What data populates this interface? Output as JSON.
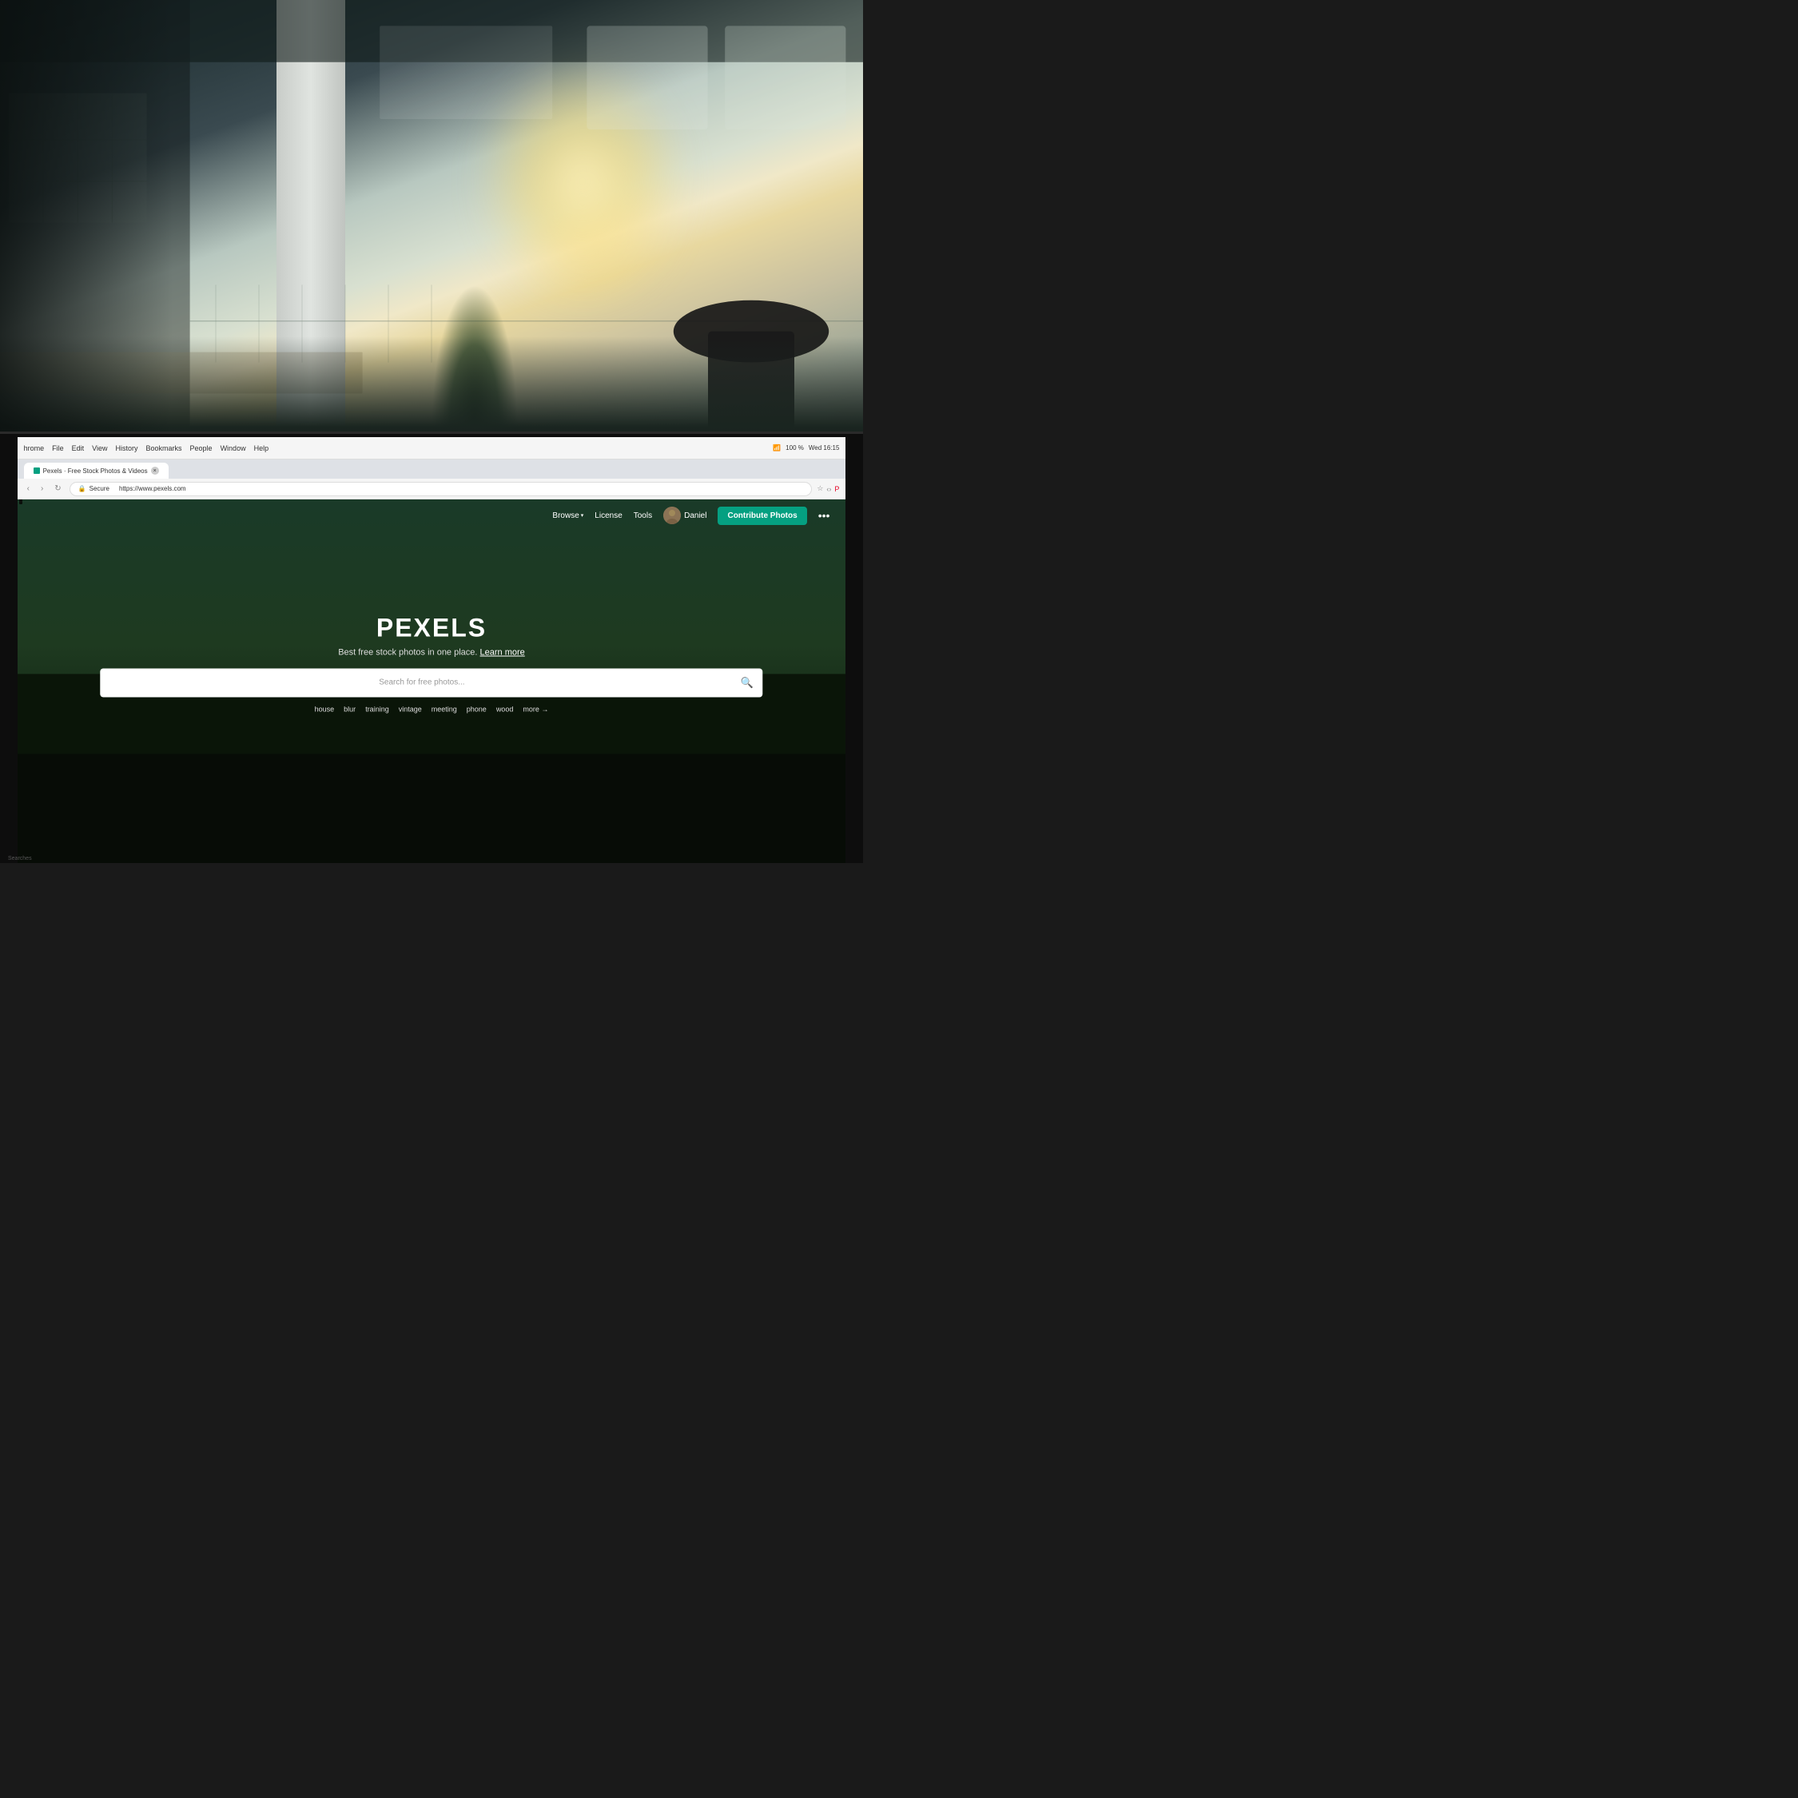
{
  "background": {
    "description": "Office workspace background photo",
    "colors": {
      "dark": "#0a0f0e",
      "mid": "#3a4a50",
      "light": "#d8e0d0",
      "glow": "#f0e8c8"
    }
  },
  "browser": {
    "menu_items": [
      "hrome",
      "File",
      "Edit",
      "View",
      "History",
      "Bookmarks",
      "People",
      "Window",
      "Help"
    ],
    "status_right": "Wed 16:15",
    "battery": "100 %",
    "tab_label": "Pexels · Free Stock Photos & Videos",
    "close_icon": "×",
    "back_icon": "‹",
    "forward_icon": "›",
    "reload_icon": "↻",
    "secure_label": "Secure",
    "url": "https://www.pexels.com",
    "address_icons": [
      "★",
      "‹",
      "♥",
      "☁",
      "⚡",
      "●",
      "○",
      "◎",
      "⊕",
      "✦"
    ]
  },
  "pexels": {
    "nav": {
      "browse_label": "Browse",
      "browse_chevron": "▾",
      "license_label": "License",
      "tools_label": "Tools",
      "user_name": "Daniel",
      "contribute_label": "Contribute Photos",
      "more_icon": "•••"
    },
    "hero": {
      "brand": "PEXELS",
      "tagline": "Best free stock photos in one place.",
      "tagline_link": "Learn more",
      "search_placeholder": "Search for free photos...",
      "search_icon": "🔍",
      "quick_tags": [
        "house",
        "blur",
        "training",
        "vintage",
        "meeting",
        "phone",
        "wood"
      ],
      "more_label": "more →"
    }
  },
  "footer": {
    "searches_label": "Searches"
  }
}
